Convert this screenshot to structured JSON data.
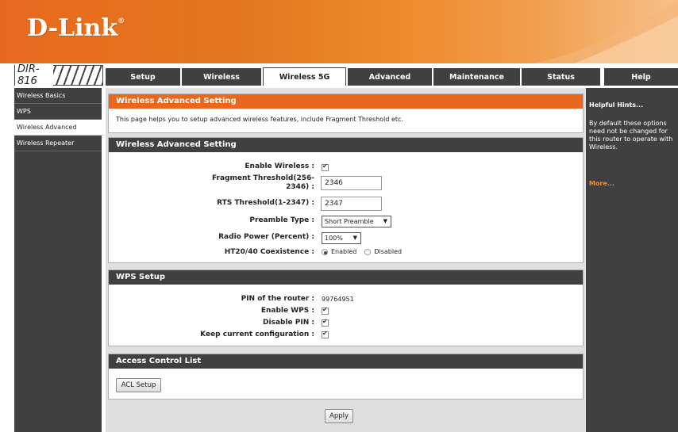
{
  "brand": {
    "logo": "D-Link",
    "trademark": "®",
    "model": "DIR-816"
  },
  "tabs": [
    {
      "label": "Setup"
    },
    {
      "label": "Wireless"
    },
    {
      "label": "Wireless 5G",
      "active": true
    },
    {
      "label": "Advanced"
    },
    {
      "label": "Maintenance"
    },
    {
      "label": "Status"
    }
  ],
  "help_tab": "Help",
  "sidebar": {
    "items": [
      {
        "label": "Wireless Basics"
      },
      {
        "label": "WPS"
      },
      {
        "label": "Wireless Advanced",
        "active": true
      },
      {
        "label": "Wireless Repeater"
      }
    ]
  },
  "intro": {
    "title": "Wireless Advanced Setting",
    "text": "This page helps you to setup advanced wireless features, include Fragment Threshold etc."
  },
  "advanced": {
    "title": "Wireless Advanced Setting",
    "enable_wireless_label": "Enable Wireless :",
    "enable_wireless_checked": true,
    "fragment_label_1": "Fragment Threshold(256-",
    "fragment_label_2": "2346) :",
    "fragment_value": "2346",
    "rts_label": "RTS Threshold(1-2347) :",
    "rts_value": "2347",
    "preamble_label": "Preamble Type :",
    "preamble_value": "Short Preamble",
    "radio_power_label": "Radio Power (Percent) :",
    "radio_power_value": "100%",
    "ht_label": "HT20/40 Coexistence :",
    "ht_enabled_label": "Enabled",
    "ht_disabled_label": "Disabled",
    "ht_selected": "Enabled"
  },
  "wps": {
    "title": "WPS Setup",
    "pin_label": "PIN of the router :",
    "pin_value": "99764951",
    "enable_wps_label": "Enable WPS :",
    "enable_wps_checked": true,
    "disable_pin_label": "Disable PIN :",
    "disable_pin_checked": true,
    "keep_config_label": "Keep current configuration :",
    "keep_config_checked": true
  },
  "acl": {
    "title": "Access Control List",
    "button": "ACL Setup"
  },
  "apply_button": "Apply",
  "help": {
    "title": "Helpful Hints...",
    "body": "By default these options need not be changed for this router to operate with Wireless.",
    "more": "More..."
  },
  "colors": {
    "accent": "#e8691e",
    "dark": "#404040",
    "panel": "#dfdfdf"
  }
}
